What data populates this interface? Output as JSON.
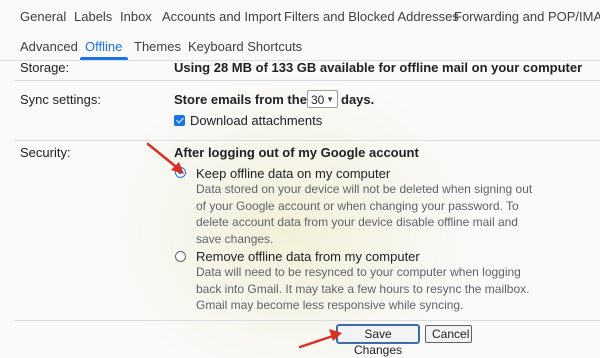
{
  "settings_tabs_row1": [
    {
      "label": "General"
    },
    {
      "label": "Labels"
    },
    {
      "label": "Inbox"
    },
    {
      "label": "Accounts and Import"
    },
    {
      "label": "Filters and Blocked Addresses"
    },
    {
      "label": "Forwarding and POP/IMAP"
    }
  ],
  "settings_tabs_row2": [
    {
      "label": "Advanced"
    },
    {
      "label": "Offline"
    },
    {
      "label": "Themes"
    },
    {
      "label": "Keyboard Shortcuts"
    }
  ],
  "active_tab": "Offline",
  "storage": {
    "label": "Storage:",
    "value": "Using 28 MB of 133 GB available for offline mail on your computer"
  },
  "sync": {
    "label": "Sync settings:",
    "prefix": "Store emails from the last",
    "days_value": "30",
    "suffix": "days.",
    "download_attachments_label": "Download attachments",
    "download_attachments_checked": true
  },
  "security": {
    "label": "Security:",
    "heading": "After logging out of my Google account",
    "options": [
      {
        "title": "Keep offline data on my computer",
        "description_lines": [
          "Data stored on your device will not be deleted when signing out",
          "of your Google account or when changing your password. To",
          "delete account data from your device disable offline mail and",
          "save changes."
        ],
        "selected": true
      },
      {
        "title": "Remove offline data from my computer",
        "description_lines": [
          "Data will need to be resynced to your computer when logging",
          "back into Gmail. It may take a few hours to resync the mailbox.",
          "Gmail may become less responsive while syncing."
        ],
        "selected": false
      }
    ]
  },
  "actions": {
    "save_label": "Save Changes",
    "cancel_label": "Cancel"
  },
  "colors": {
    "accent": "#1a73e8",
    "annotation_arrow": "#d93025"
  },
  "icons": {
    "dropdown": "caret-down-icon",
    "annotation": "red-arrow-icon"
  }
}
